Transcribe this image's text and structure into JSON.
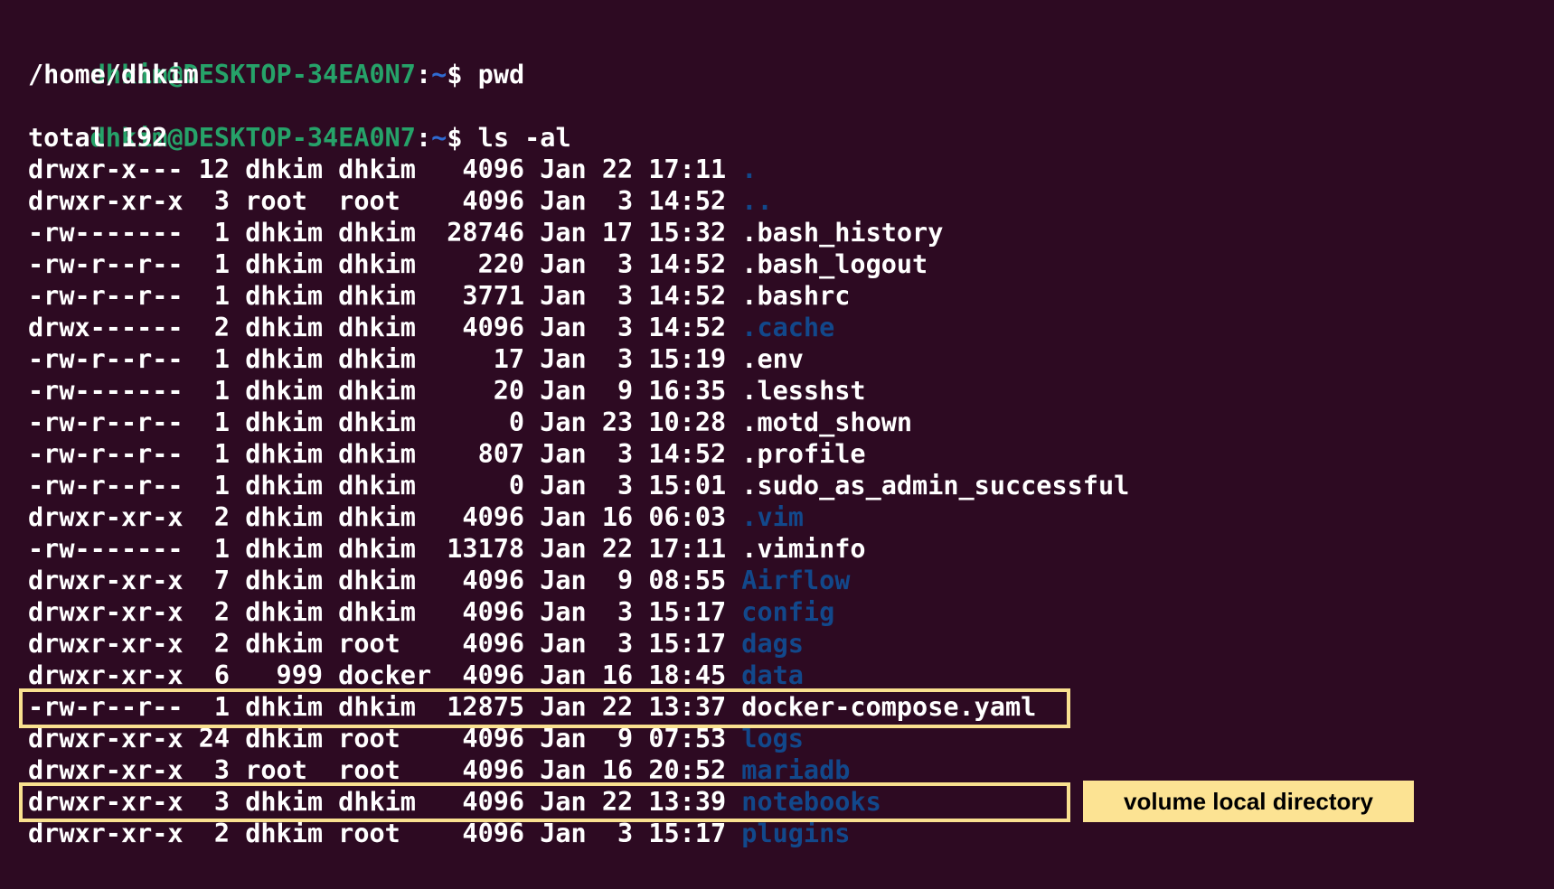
{
  "prompt": {
    "user_host": "dhkim@DESKTOP-34EA0N7",
    "separator": ":",
    "path": "~",
    "symbol": "$"
  },
  "commands": [
    {
      "cmd": "pwd",
      "output": "/home/dhkim"
    },
    {
      "cmd": "ls -al",
      "output": "total 192"
    }
  ],
  "listing": [
    {
      "meta": "drwxr-x--- 12 dhkim dhkim   4096 Jan 22 17:11 ",
      "name": ".",
      "type": "dir"
    },
    {
      "meta": "drwxr-xr-x  3 root  root    4096 Jan  3 14:52 ",
      "name": "..",
      "type": "dir"
    },
    {
      "meta": "-rw-------  1 dhkim dhkim  28746 Jan 17 15:32 ",
      "name": ".bash_history",
      "type": "file"
    },
    {
      "meta": "-rw-r--r--  1 dhkim dhkim    220 Jan  3 14:52 ",
      "name": ".bash_logout",
      "type": "file"
    },
    {
      "meta": "-rw-r--r--  1 dhkim dhkim   3771 Jan  3 14:52 ",
      "name": ".bashrc",
      "type": "file"
    },
    {
      "meta": "drwx------  2 dhkim dhkim   4096 Jan  3 14:52 ",
      "name": ".cache",
      "type": "dir"
    },
    {
      "meta": "-rw-r--r--  1 dhkim dhkim     17 Jan  3 15:19 ",
      "name": ".env",
      "type": "file"
    },
    {
      "meta": "-rw-------  1 dhkim dhkim     20 Jan  9 16:35 ",
      "name": ".lesshst",
      "type": "file"
    },
    {
      "meta": "-rw-r--r--  1 dhkim dhkim      0 Jan 23 10:28 ",
      "name": ".motd_shown",
      "type": "file"
    },
    {
      "meta": "-rw-r--r--  1 dhkim dhkim    807 Jan  3 14:52 ",
      "name": ".profile",
      "type": "file"
    },
    {
      "meta": "-rw-r--r--  1 dhkim dhkim      0 Jan  3 15:01 ",
      "name": ".sudo_as_admin_successful",
      "type": "file"
    },
    {
      "meta": "drwxr-xr-x  2 dhkim dhkim   4096 Jan 16 06:03 ",
      "name": ".vim",
      "type": "dir"
    },
    {
      "meta": "-rw-------  1 dhkim dhkim  13178 Jan 22 17:11 ",
      "name": ".viminfo",
      "type": "file"
    },
    {
      "meta": "drwxr-xr-x  7 dhkim dhkim   4096 Jan  9 08:55 ",
      "name": "Airflow",
      "type": "dir"
    },
    {
      "meta": "drwxr-xr-x  2 dhkim dhkim   4096 Jan  3 15:17 ",
      "name": "config",
      "type": "dir"
    },
    {
      "meta": "drwxr-xr-x  2 dhkim root    4096 Jan  3 15:17 ",
      "name": "dags",
      "type": "dir"
    },
    {
      "meta": "drwxr-xr-x  6   999 docker  4096 Jan 16 18:45 ",
      "name": "data",
      "type": "dir"
    },
    {
      "meta": "-rw-r--r--  1 dhkim dhkim  12875 Jan 22 13:37 ",
      "name": "docker-compose.yaml",
      "type": "file"
    },
    {
      "meta": "drwxr-xr-x 24 dhkim root    4096 Jan  9 07:53 ",
      "name": "logs",
      "type": "dir"
    },
    {
      "meta": "drwxr-xr-x  3 root  root    4096 Jan 16 20:52 ",
      "name": "mariadb",
      "type": "dir"
    },
    {
      "meta": "drwxr-xr-x  3 dhkim dhkim   4096 Jan 22 13:39 ",
      "name": "notebooks",
      "type": "dir"
    },
    {
      "meta": "drwxr-xr-x  2 dhkim root    4096 Jan  3 15:17 ",
      "name": "plugins",
      "type": "dir"
    }
  ],
  "annotation": {
    "callout_text": "volume local directory",
    "box_color": "#f9e08f",
    "callout_color": "#fce393"
  },
  "colors": {
    "background": "#2d0a22",
    "prompt_user": "#26a269",
    "prompt_path": "#2f6bd1",
    "directory": "#12488b",
    "text": "#ffffff"
  }
}
